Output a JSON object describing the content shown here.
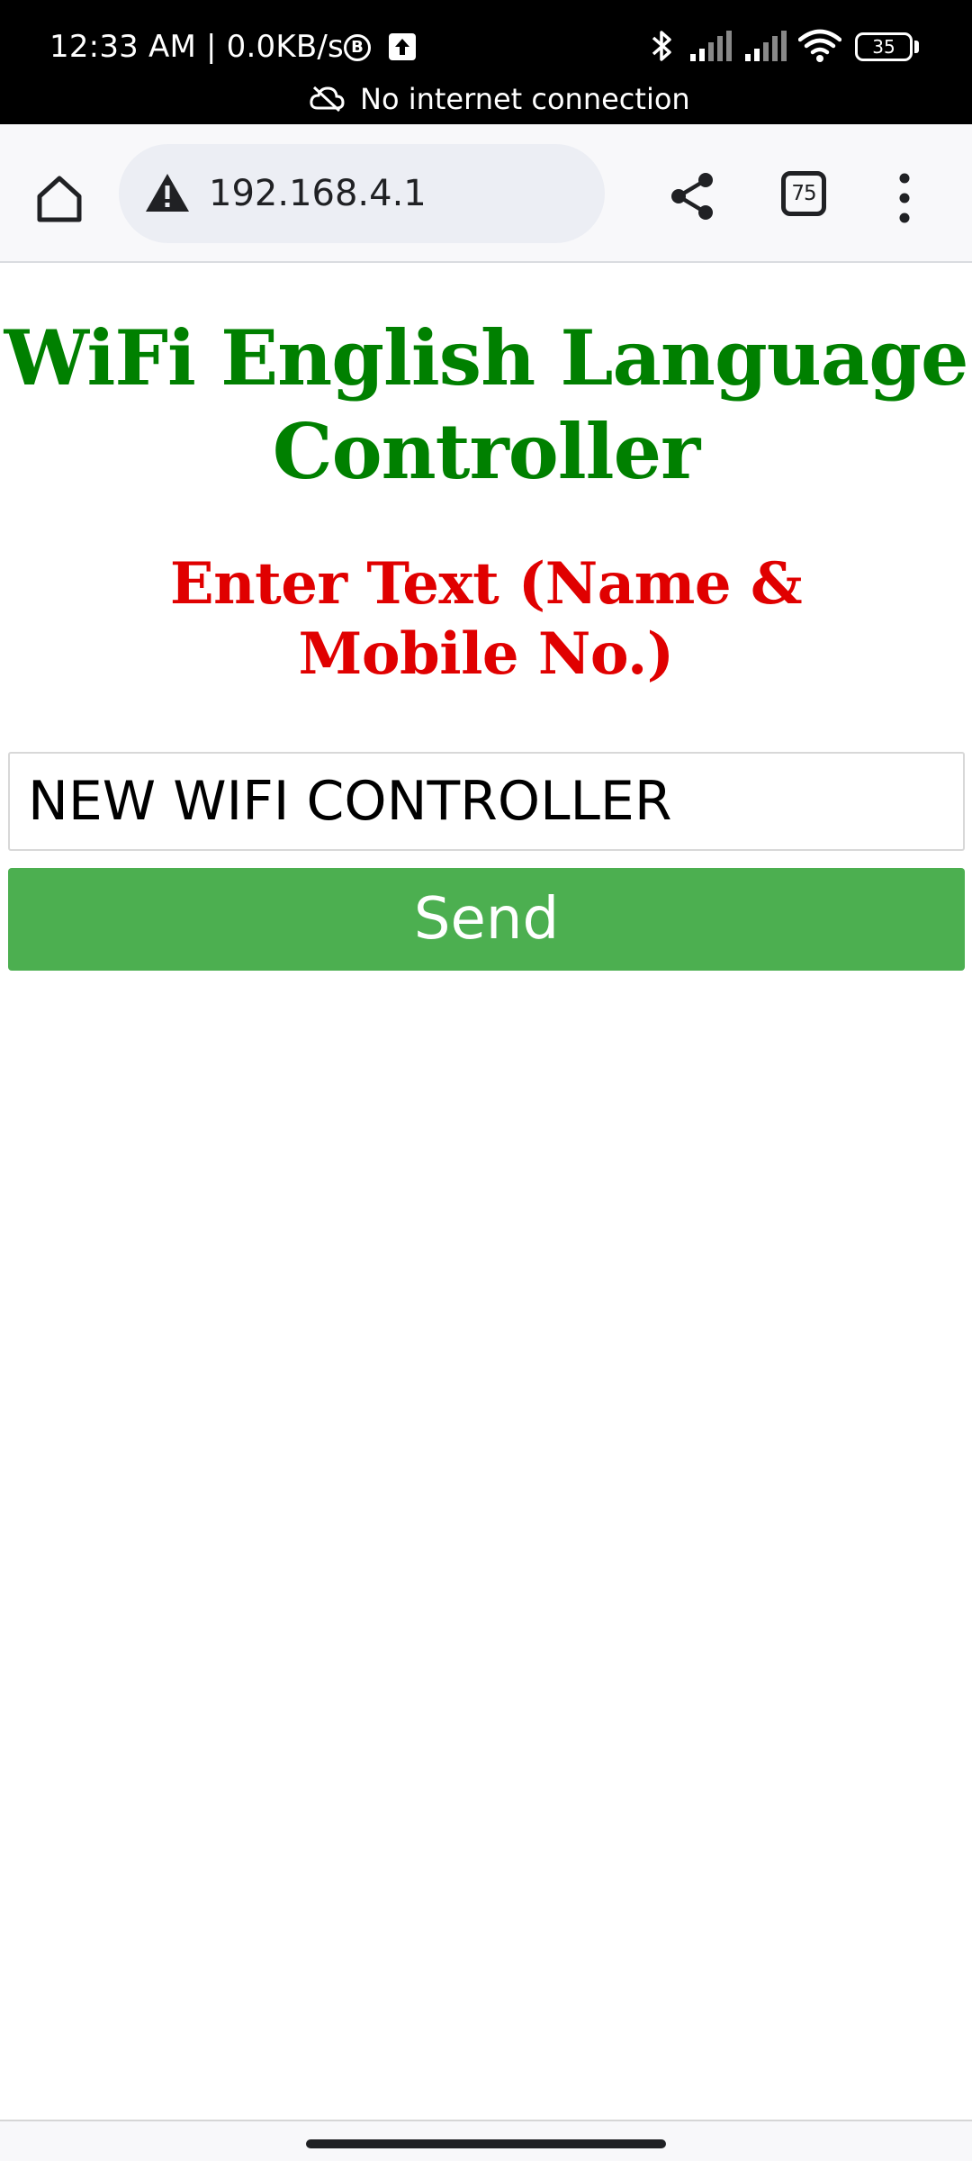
{
  "status_bar": {
    "time": "12:33 AM | 0.0KB/s",
    "b_badge": "B",
    "battery_level": "35",
    "network_notice": "No internet connection"
  },
  "browser": {
    "url": "192.168.4.1",
    "tab_count": "75",
    "icons": {
      "home": "home-icon",
      "security": "warning-icon",
      "share": "share-icon",
      "tabs": "tab-switcher-icon",
      "menu": "more-vert-icon"
    }
  },
  "page": {
    "title": "WiFi English Language Controller",
    "subtitle": "Enter Text (Name & Mobile No.)",
    "input_value": "NEW WIFI CONTROLLER",
    "send_label": "Send",
    "colors": {
      "title": "#008000",
      "subtitle": "#e00000",
      "button": "#4caf50"
    }
  }
}
